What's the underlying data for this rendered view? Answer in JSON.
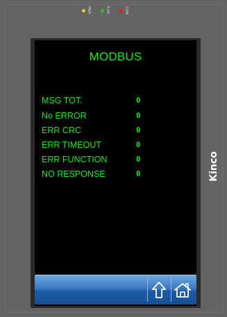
{
  "leds": [
    {
      "name": "pwr",
      "label": "PWR",
      "color": "#f2c81a"
    },
    {
      "name": "run",
      "label": "RUN",
      "color": "#22cc22"
    },
    {
      "name": "com",
      "label": "COM",
      "color": "#e02020"
    }
  ],
  "screen": {
    "title": "MODBUS",
    "rows": [
      {
        "label": "MSG TOT.",
        "value": "0"
      },
      {
        "label": "No ERROR",
        "value": "0"
      },
      {
        "label": "ERR CRC",
        "value": "0"
      },
      {
        "label": "ERR TIMEOUT",
        "value": "0"
      },
      {
        "label": "ERR FUNCTION",
        "value": "0"
      },
      {
        "label": "NO RESPONSE",
        "value": "0"
      }
    ]
  },
  "navbar": {
    "buttons": [
      {
        "name": "up",
        "icon": "up-arrow-icon"
      },
      {
        "name": "home",
        "icon": "home-icon"
      }
    ]
  },
  "brand": {
    "text": "Kinco"
  },
  "colors": {
    "accent_text": "#17e617",
    "navbar": "#2a68b2"
  }
}
